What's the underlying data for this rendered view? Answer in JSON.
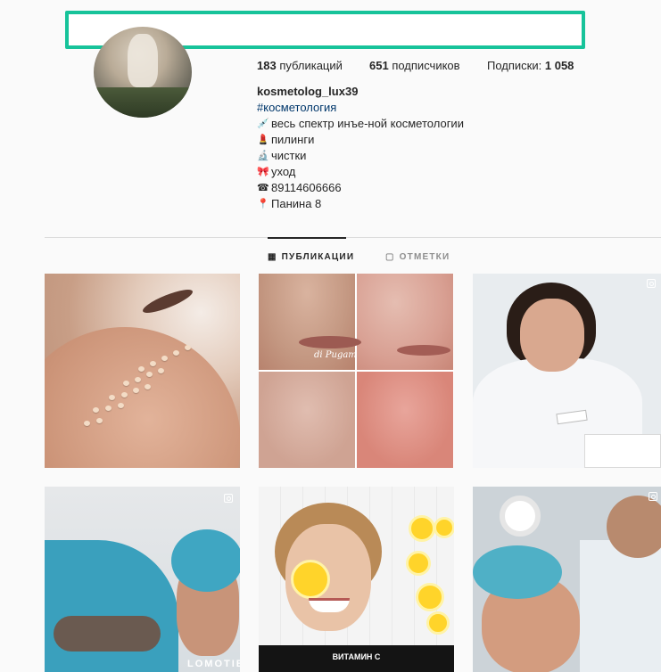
{
  "profile": {
    "stats": {
      "posts_count": "183",
      "posts_label": "публикаций",
      "followers_count": "651",
      "followers_label": "подписчиков",
      "following_label": "Подписки:",
      "following_count": "1 058"
    },
    "bio": {
      "username": "kosmetolog_lux39",
      "hashtag": "#косметология",
      "lines": [
        {
          "icon": "syringe-icon",
          "glyph": "💉",
          "text": "весь спектр инъе-ной косметологии"
        },
        {
          "icon": "lipstick-icon",
          "glyph": "💄",
          "text": "пилинги"
        },
        {
          "icon": "microscope-icon",
          "glyph": "🔬",
          "text": "чистки"
        },
        {
          "icon": "ribbon-icon",
          "glyph": "🎀",
          "text": "уход"
        },
        {
          "icon": "phone-icon",
          "glyph": "☎",
          "text": "89114606666"
        },
        {
          "icon": "pin-icon",
          "glyph": "📍",
          "text": "Панина 8"
        }
      ]
    }
  },
  "tabs": [
    {
      "label": "ПУБЛИКАЦИИ",
      "icon": "grid-icon",
      "active": true
    },
    {
      "label": "ОТМЕТКИ",
      "icon": "tag-icon",
      "active": false
    }
  ],
  "grid": {
    "tile4_logo": "LOMOTIE",
    "tile5_banner": "ВИТАМИН С",
    "tile2_signature": "di Pugam"
  },
  "colors": {
    "highlight_box": "#17c39a",
    "hashtag": "#00376b"
  }
}
